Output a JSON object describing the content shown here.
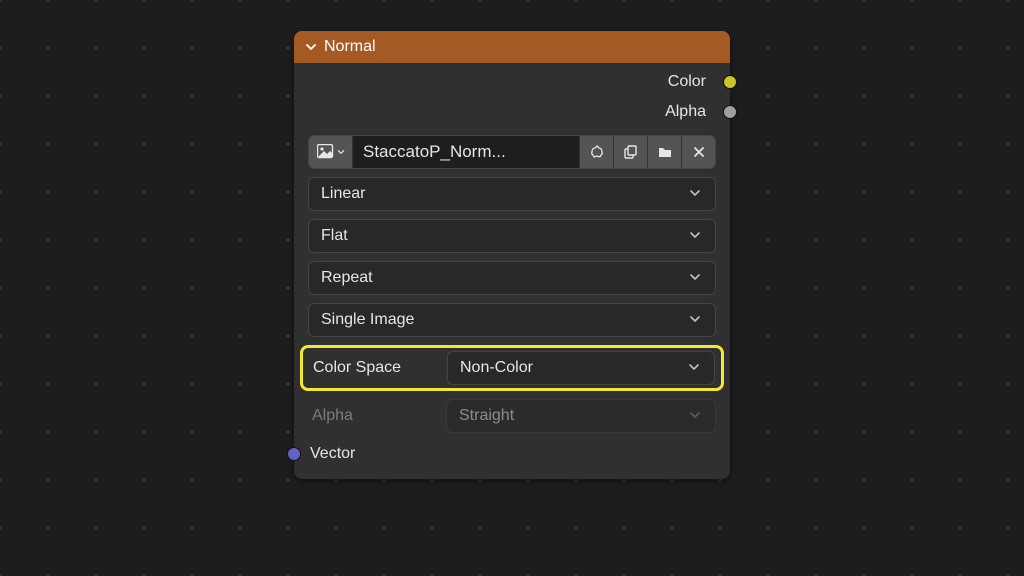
{
  "node": {
    "title": "Normal",
    "outputs": [
      {
        "label": "Color",
        "color": "#c7c729"
      },
      {
        "label": "Alpha",
        "color": "#a0a0a0"
      }
    ],
    "image_field": {
      "name": "StaccatoP_Norm..."
    },
    "dropdowns": {
      "interpolation": "Linear",
      "projection": "Flat",
      "extension": "Repeat",
      "source": "Single Image"
    },
    "color_space": {
      "label": "Color Space",
      "value": "Non-Color"
    },
    "alpha_mode": {
      "label": "Alpha",
      "value": "Straight"
    },
    "inputs": [
      {
        "label": "Vector",
        "color": "#6363c7"
      }
    ]
  },
  "colors": {
    "highlight": "#f2e63a"
  }
}
